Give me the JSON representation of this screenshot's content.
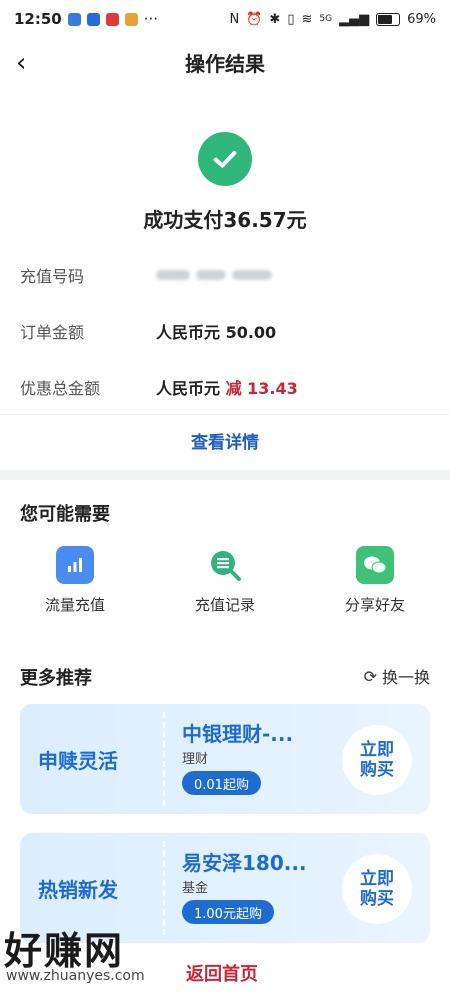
{
  "statusbar": {
    "time": "12:50",
    "more": "···",
    "network": "5G",
    "battery": "69%"
  },
  "nav": {
    "title": "操作结果"
  },
  "result": {
    "amount_text": "成功支付36.57元",
    "rows": [
      {
        "label": "充值号码",
        "value": ""
      },
      {
        "label": "订单金额",
        "value": "人民币元 50.00"
      },
      {
        "label": "优惠总金额",
        "value_prefix": "人民币元 ",
        "discount": "减 13.43"
      }
    ],
    "detail_link": "查看详情"
  },
  "needs": {
    "title": "您可能需要",
    "items": [
      {
        "label": "流量充值",
        "icon": "data-topup-icon"
      },
      {
        "label": "充值记录",
        "icon": "record-search-icon"
      },
      {
        "label": "分享好友",
        "icon": "wechat-icon"
      }
    ]
  },
  "recommend": {
    "title": "更多推荐",
    "refresh": "换一换",
    "cards": [
      {
        "tag": "申赎灵活",
        "name": "中银理财-...",
        "type": "理财",
        "badge": "0.01起购",
        "buy": [
          "立即",
          "购买"
        ]
      },
      {
        "tag": "热销新发",
        "name": "易安泽180...",
        "type": "基金",
        "badge": "1.00元起购",
        "buy": [
          "立即",
          "购买"
        ]
      }
    ]
  },
  "footer": {
    "home_link": "返回首页",
    "watermark": "好赚网",
    "watermark_url": "www.zhuanyes.com"
  },
  "colors": {
    "accent": "#1f6cd1",
    "success": "#2fb67a",
    "discount": "#c8273a"
  }
}
